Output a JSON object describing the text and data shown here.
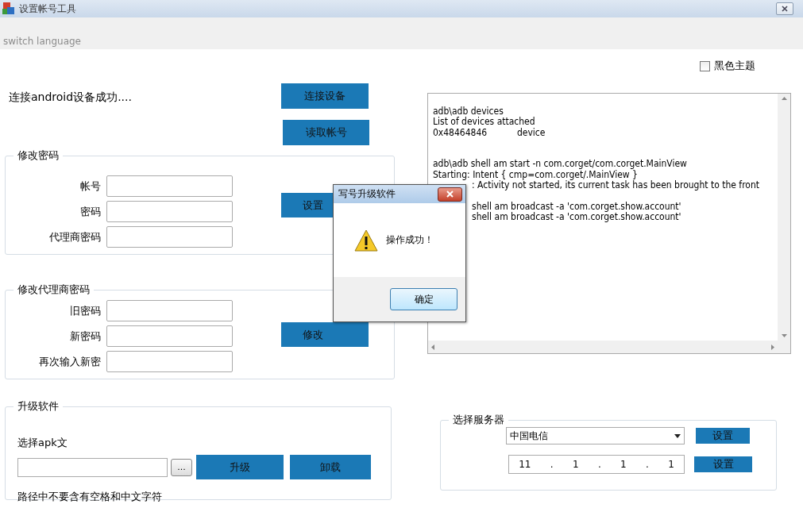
{
  "window": {
    "title": "设置帐号工具"
  },
  "menu": {
    "label": "switch language"
  },
  "theme_checkbox": {
    "label": "黑色主题",
    "checked": false
  },
  "status": "连接android设备成功....",
  "top_buttons": [
    "连接设备",
    "读取帐号"
  ],
  "change_password": {
    "title": "修改密码",
    "fields": [
      {
        "label": "帐号"
      },
      {
        "label": "密码"
      },
      {
        "label": "代理商密码"
      }
    ],
    "button": "设置"
  },
  "change_agent_password": {
    "title": "修改代理商密码",
    "fields": [
      {
        "label": "旧密码"
      },
      {
        "label": "新密码"
      },
      {
        "label": "再次输入新密"
      }
    ],
    "button": "修改"
  },
  "upgrade": {
    "title": "升级软件",
    "file_label": "选择apk文",
    "browse_button": "...",
    "buttons": [
      "升级",
      "卸载"
    ],
    "note": "路径中不要含有空格和中文字符"
  },
  "console": {
    "lines": [
      {
        "kind": "full",
        "text": "adb\\adb devices"
      },
      {
        "kind": "full",
        "text": "List of devices attached"
      },
      {
        "kind": "full",
        "text": "0x48464846           device"
      },
      {
        "kind": "blank"
      },
      {
        "kind": "blank"
      },
      {
        "kind": "full",
        "text": "adb\\adb shell am start -n com.corget/com.corget.MainView"
      },
      {
        "kind": "full",
        "text": "Starting: Intent { cmp=com.corget/.MainView }"
      },
      {
        "kind": "partial",
        "text": ": Activity not started, its current task has been brought to the front"
      },
      {
        "kind": "blank"
      },
      {
        "kind": "partial",
        "text": "shell am broadcast -a 'com.corget.show.account'"
      },
      {
        "kind": "partial",
        "text": "shell am broadcast -a 'com.corget.show.account'"
      }
    ]
  },
  "server": {
    "title": "选择服务器",
    "dropdown": "中国电信",
    "ip": [
      "11",
      ".",
      "1",
      ".",
      "1",
      ".",
      "1"
    ],
    "buttons": [
      "设置",
      "设置"
    ]
  },
  "dialog": {
    "title": "写号升级软件",
    "message": "操作成功！",
    "button": "确定"
  }
}
